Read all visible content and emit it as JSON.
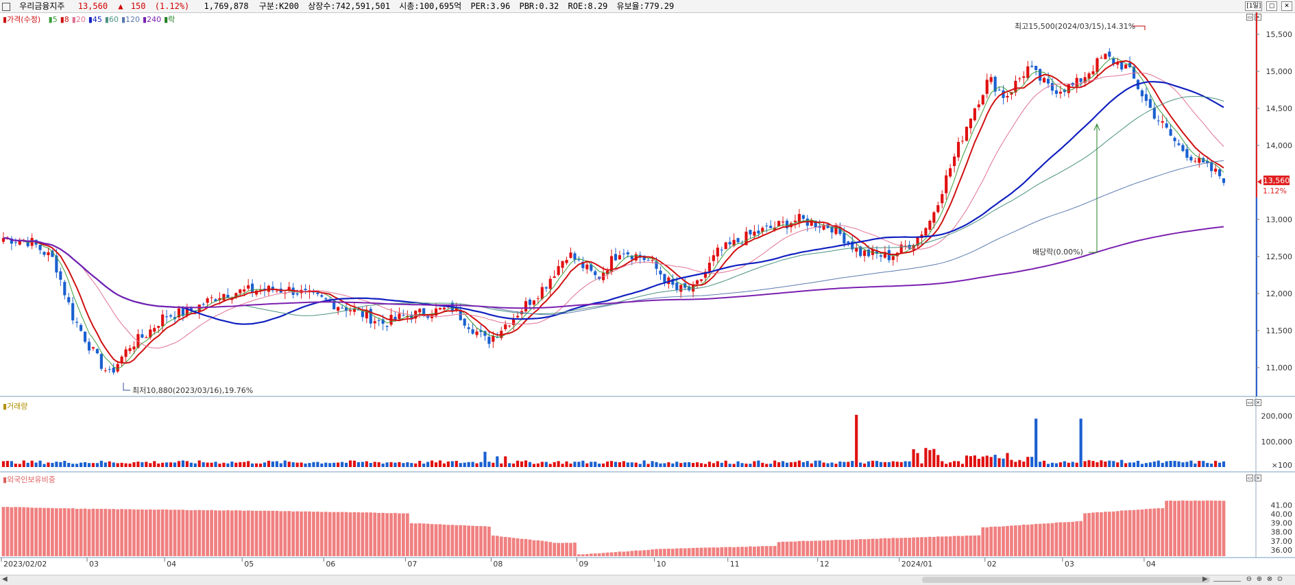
{
  "header": {
    "stock_name": "우리금융지주",
    "price": "13,560",
    "change_arrow": "▲",
    "change": "150",
    "change_pct": "(1.12%)",
    "volume": "1,769,878",
    "market": "구분:K200",
    "shares": "상장수:742,591,501",
    "market_cap": "시총:100,695억",
    "per": "PER:3.96",
    "pbr": "PBR:0.32",
    "roe": "ROE:8.29",
    "retention": "유보율:779.29",
    "period_button": "[1일]",
    "restore_icon": "restore-icon",
    "close_icon": "close-icon"
  },
  "price_panel": {
    "legend_title": "가격(수정)",
    "ma_labels": [
      "5",
      "8",
      "20",
      "45",
      "60",
      "120",
      "240",
      "락"
    ],
    "ma_colors": [
      "#3a9c3a",
      "#d01010",
      "#e07090",
      "#1020c0",
      "#4a9080",
      "#5a7ab0",
      "#7a20b0",
      "#208020"
    ],
    "annot_high": "최고15,500(2024/03/15),14.31%",
    "annot_low": "최저10,880(2023/03/16),19.76%",
    "annot_dividend": "배당락(0.00%)",
    "current_price_label": "13,560",
    "current_pct_label": "1.12%",
    "y_ticks": [
      "15,500",
      "15,000",
      "14,500",
      "14,000",
      "13,000",
      "12,500",
      "12,000",
      "11,500",
      "11,000"
    ]
  },
  "volume_panel": {
    "legend_title": "거래량",
    "y_ticks": [
      "200,000",
      "100,000",
      "×100"
    ]
  },
  "foreign_panel": {
    "legend_title": "외국인보유비중",
    "y_ticks": [
      "41.00",
      "40.00",
      "39.00",
      "38.00",
      "37.00",
      "36.00"
    ]
  },
  "x_axis": [
    "2023/02/02",
    "03",
    "04",
    "05",
    "06",
    "07",
    "08",
    "09",
    "10",
    "11",
    "12",
    "2024/01",
    "02",
    "03",
    "04"
  ],
  "colors": {
    "up": "#e01010",
    "down": "#1a60d0",
    "foreign_bar": "#f08080",
    "ma240": "#7a20b0",
    "ma45": "#1020c0"
  }
}
